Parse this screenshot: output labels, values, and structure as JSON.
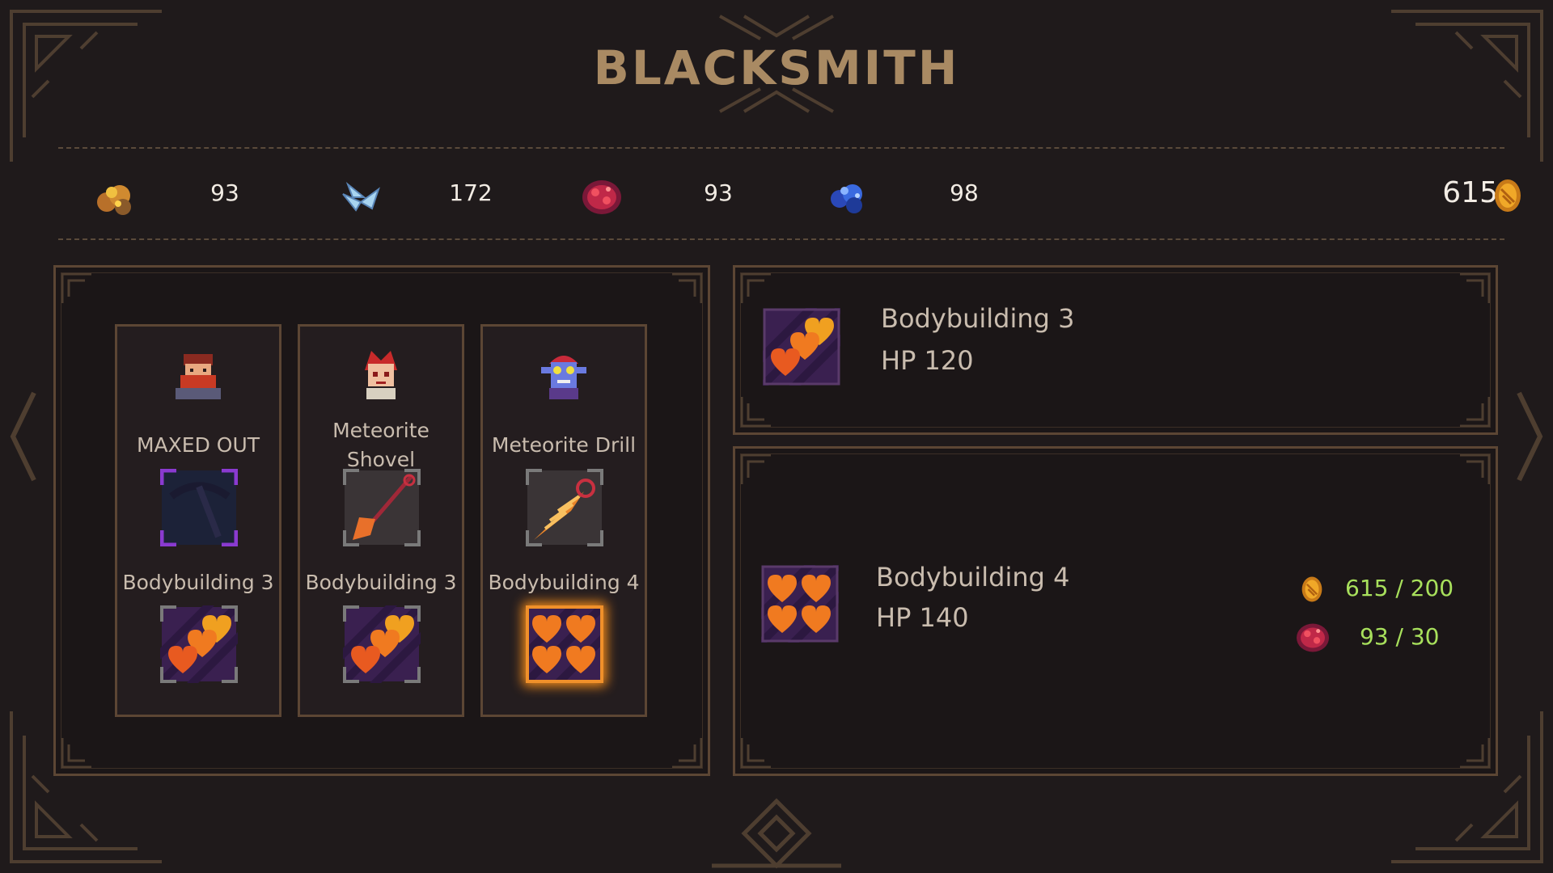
{
  "title": "BLACKSMITH",
  "resources": [
    {
      "icon": "copper-ore-icon",
      "count": "93"
    },
    {
      "icon": "crystal-shard-icon",
      "count": "172"
    },
    {
      "icon": "meteorite-ore-icon",
      "count": "93"
    },
    {
      "icon": "sapphire-ore-icon",
      "count": "98"
    }
  ],
  "gold": {
    "icon": "gold-coin-icon",
    "count": "615"
  },
  "columns": [
    {
      "portrait": "dwarf-portrait-icon",
      "name": "MAXED OUT",
      "item_icon": "pickaxe-icon",
      "upgrade_label": "Bodybuilding 3",
      "upgrade_icon": "three-hearts-icon",
      "selected": false
    },
    {
      "portrait": "redhead-elf-portrait-icon",
      "name": "Meteorite Shovel",
      "item_icon": "shovel-icon",
      "upgrade_label": "Bodybuilding 3",
      "upgrade_icon": "three-hearts-icon",
      "selected": false
    },
    {
      "portrait": "goblin-portrait-icon",
      "name": "Meteorite Drill",
      "item_icon": "drill-icon",
      "upgrade_label": "Bodybuilding 4",
      "upgrade_icon": "four-hearts-icon",
      "selected": true
    }
  ],
  "current": {
    "icon": "three-hearts-icon",
    "name": "Bodybuilding 3",
    "hp": "HP 120"
  },
  "next": {
    "icon": "four-hearts-icon",
    "name": "Bodybuilding 4",
    "hp": "HP 140",
    "costs": [
      {
        "icon": "gold-coin-icon",
        "text": "615 / 200"
      },
      {
        "icon": "meteorite-ore-icon",
        "text": "93 / 30"
      }
    ]
  },
  "colors": {
    "background": "#1f1a1b",
    "frame": "#5c4634",
    "title": "#a98a63",
    "text": "#c9bcae",
    "cost_ok": "#a8e05c",
    "highlight": "#f08a1a"
  }
}
